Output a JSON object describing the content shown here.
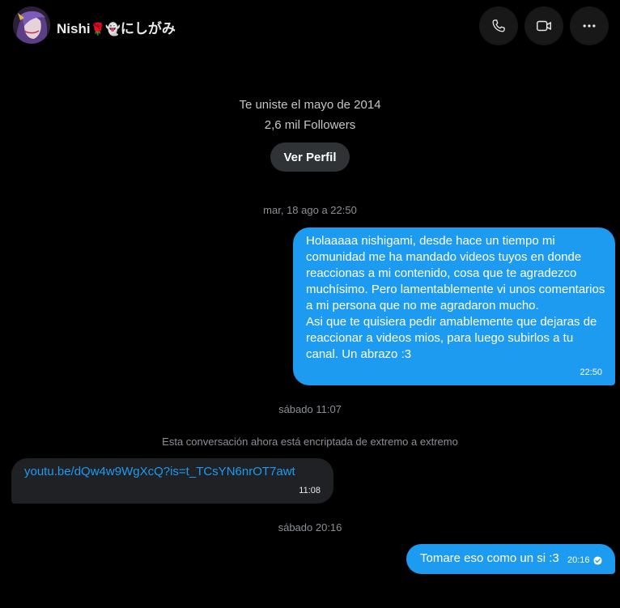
{
  "header": {
    "name": "Nishi",
    "name_emojis": "🌹👻",
    "name_suffix": "にしがみ",
    "icons": {
      "call": "phone-icon",
      "video": "video-camera-icon",
      "more": "more-horizontal-icon"
    }
  },
  "profile": {
    "joined": "Te uniste el mayo de 2014",
    "followers": "2,6 mil Followers",
    "view_profile_label": "Ver Perfil"
  },
  "conversation": {
    "timestamp_1": "mar, 18 ago a 22:50",
    "message_1": {
      "text": "Holaaaaa nishigami, desde hace un tiempo mi comunidad me ha mandado videos tuyos en donde reaccionas a mi contenido, cosa que te agradezco muchísimo. Pero lamentablemente vi unos comentarios a mi persona que no me agradaron mucho.\nAsi que te quisiera pedir amablemente que dejaras de reaccionar a videos mios, para luego subirlos a tu canal. Un abrazo :3",
      "time": "22:50"
    },
    "timestamp_2": "sábado 11:07",
    "encryption_notice": "Esta conversación ahora está encriptada de extremo a extremo",
    "message_2": {
      "text": "youtu.be/dQw4w9WgXcQ?is=t_TCsYN6nrOT7awt",
      "time": "11:08"
    },
    "timestamp_3": "sábado 20:16",
    "message_3": {
      "text": "Tomare eso como un si :3",
      "time": "20:16",
      "status_icon": "read-check-icon"
    }
  },
  "colors": {
    "background": "#000000",
    "outgoing_bubble": "#1d9bf0",
    "incoming_bubble": "#1f2125",
    "link": "#1d9bf0",
    "button": "#2f3336",
    "muted_text": "#8b9096"
  }
}
